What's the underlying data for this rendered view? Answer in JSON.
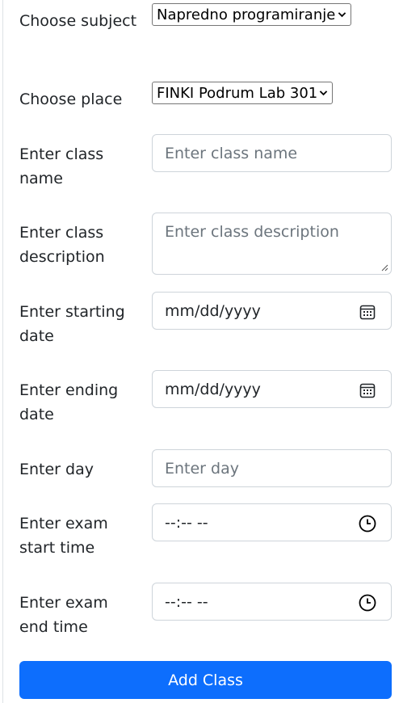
{
  "form": {
    "subject": {
      "label": "Choose subject",
      "selected": "Napredno programiranje"
    },
    "place": {
      "label": "Choose place",
      "selected": "FINKI Podrum Lab 301"
    },
    "class_name": {
      "label": "Enter class name",
      "placeholder": "Enter class name"
    },
    "class_description": {
      "label": "Enter class description",
      "placeholder": "Enter class description"
    },
    "starting_date": {
      "label": "Enter starting date",
      "value": "mm/dd/yyyy",
      "icon": "calendar-icon"
    },
    "ending_date": {
      "label": "Enter ending date",
      "value": "mm/dd/yyyy",
      "icon": "calendar-icon"
    },
    "day": {
      "label": "Enter day",
      "placeholder": "Enter day"
    },
    "exam_start": {
      "label": "Enter exam start time",
      "value": "--:-- --",
      "icon": "clock-icon"
    },
    "exam_end": {
      "label": "Enter exam end time",
      "value": "--:-- --",
      "icon": "clock-icon"
    },
    "submit_label": "Add Class"
  },
  "colors": {
    "primary": "#0d6efd",
    "border": "#ced4da",
    "placeholder": "#6c757d"
  }
}
